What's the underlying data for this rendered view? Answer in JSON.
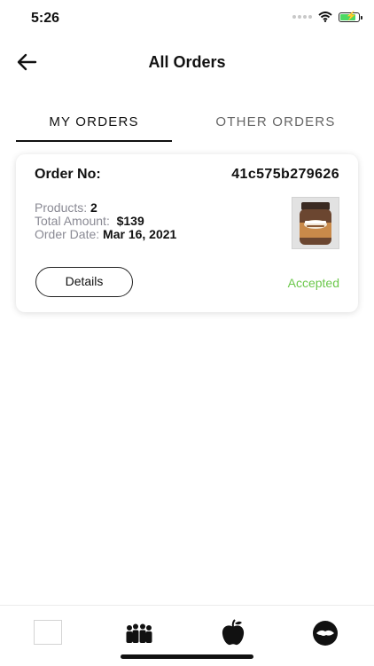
{
  "status_bar": {
    "time": "5:26",
    "battery_level": 0.75
  },
  "header": {
    "title": "All Orders"
  },
  "tabs": [
    {
      "label": "MY ORDERS",
      "active": true
    },
    {
      "label": "OTHER ORDERS",
      "active": false
    }
  ],
  "order": {
    "order_label": "Order No:",
    "order_number": "41c575b279626",
    "products_label": "Products:",
    "products_value": "2",
    "total_label": "Total Amount:",
    "total_value": "$139",
    "date_label": "Order Date:",
    "date_value": "Mar 16, 2021",
    "thumbnail": {
      "icon": "peanut-butter-jar-icon"
    },
    "details_label": "Details",
    "status": "Accepted",
    "status_color": "#6cc84c"
  },
  "tab_bar": {
    "items": [
      {
        "icon": "blank-square-icon"
      },
      {
        "icon": "group-people-icon"
      },
      {
        "icon": "apple-icon"
      },
      {
        "icon": "handshake-icon"
      }
    ]
  }
}
